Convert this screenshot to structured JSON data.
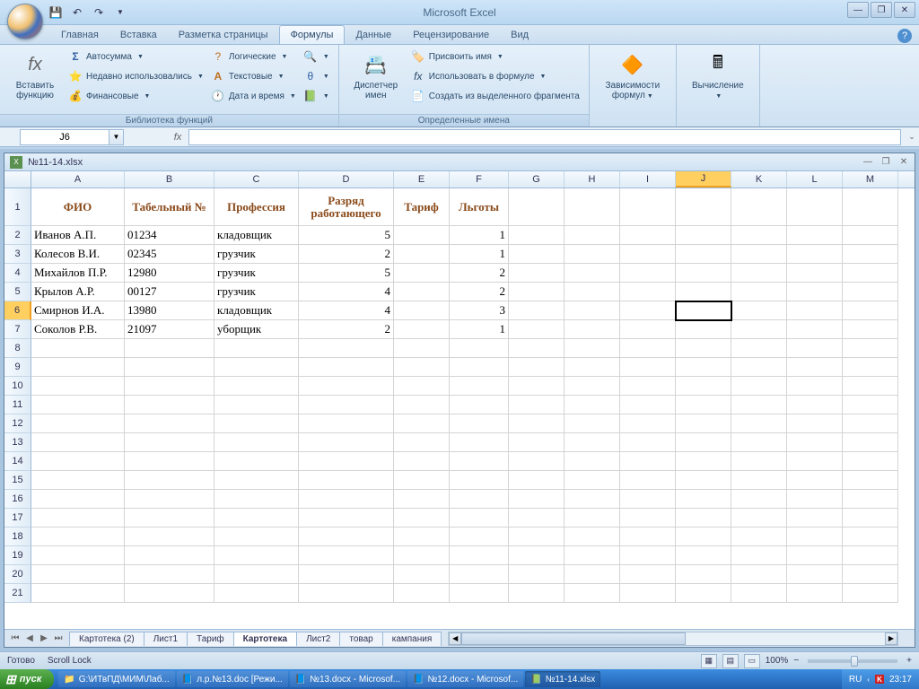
{
  "app_title": "Microsoft Excel",
  "tabs": [
    "Главная",
    "Вставка",
    "Разметка страницы",
    "Формулы",
    "Данные",
    "Рецензирование",
    "Вид"
  ],
  "active_tab": 3,
  "ribbon": {
    "insert_fn": {
      "label": "Вставить функцию",
      "icon": "fx"
    },
    "lib": {
      "autosum": "Автосумма",
      "recent": "Недавно использовались",
      "financial": "Финансовые",
      "logical": "Логические",
      "text": "Текстовые",
      "date": "Дата и время",
      "group_label": "Библиотека функций"
    },
    "names": {
      "manager": "Диспетчер имен",
      "assign": "Присвоить имя",
      "use": "Использовать в формуле",
      "create": "Создать из выделенного фрагмента",
      "group_label": "Определенные имена"
    },
    "deps": "Зависимости формул",
    "calc": "Вычисление"
  },
  "name_box": "J6",
  "formula_value": "",
  "workbook_name": "№11-14.xlsx",
  "columns": [
    "A",
    "B",
    "C",
    "D",
    "E",
    "F",
    "G",
    "H",
    "I",
    "J",
    "K",
    "L",
    "M"
  ],
  "headers": {
    "A": "ФИО",
    "B": "Табельный №",
    "C": "Профессия",
    "D": "Разряд работающего",
    "E": "Тариф",
    "F": "Льготы"
  },
  "rows": [
    {
      "A": "Иванов А.П.",
      "B": "01234",
      "C": "кладовщик",
      "D": "5",
      "E": "",
      "F": "1"
    },
    {
      "A": "Колесов В.И.",
      "B": "02345",
      "C": "грузчик",
      "D": "2",
      "E": "",
      "F": "1"
    },
    {
      "A": "Михайлов П.Р.",
      "B": "12980",
      "C": "грузчик",
      "D": "5",
      "E": "",
      "F": "2"
    },
    {
      "A": "Крылов А.Р.",
      "B": "00127",
      "C": "грузчик",
      "D": "4",
      "E": "",
      "F": "2"
    },
    {
      "A": "Смирнов И.А.",
      "B": "13980",
      "C": "кладовщик",
      "D": "4",
      "E": "",
      "F": "3"
    },
    {
      "A": "Соколов Р.В.",
      "B": "21097",
      "C": "уборщик",
      "D": "2",
      "E": "",
      "F": "1"
    }
  ],
  "selected_cell": "J6",
  "sheets": [
    "Картотека (2)",
    "Лист1",
    "Тариф",
    "Картотека",
    "Лист2",
    "товар",
    "кампания"
  ],
  "active_sheet": 3,
  "status": {
    "ready": "Готово",
    "scroll": "Scroll Lock",
    "zoom": "100%"
  },
  "taskbar": {
    "start": "пуск",
    "items": [
      "G:\\ИТвПД\\МИМ\\Лаб...",
      "л.р.№13.doc [Режи...",
      "№13.docx - Microsof...",
      "№12.docx - Microsof...",
      "№11-14.xlsx"
    ],
    "active_item": 4,
    "lang": "RU",
    "time": "23:17"
  }
}
